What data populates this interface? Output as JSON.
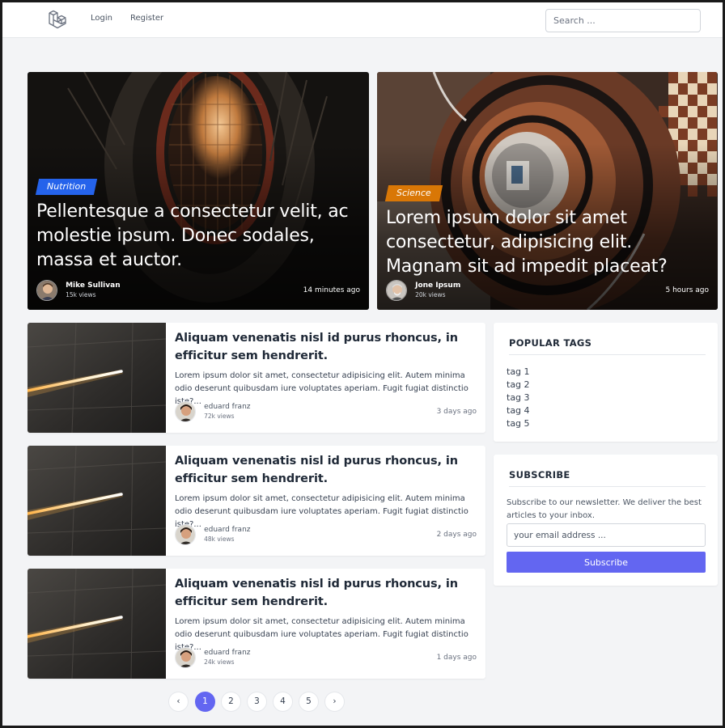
{
  "nav": {
    "login": "Login",
    "register": "Register",
    "search_placeholder": "Search ..."
  },
  "hero": [
    {
      "category": "Nutrition",
      "category_color": "#2563eb",
      "title": "Pellentesque a consectetur velit, ac molestie ipsum. Donec sodales, massa et auctor.",
      "author": "Mike Sullivan",
      "views": "15k views",
      "time": "14 minutes ago"
    },
    {
      "category": "Science",
      "category_color": "#d97706",
      "title": "Lorem ipsum dolor sit amet consectetur, adipisicing elit. Magnam sit ad impedit placeat?",
      "author": "Jone Ipsum",
      "views": "20k views",
      "time": "5 hours ago"
    }
  ],
  "posts": [
    {
      "title": "Aliquam venenatis nisl id purus rhoncus, in efficitur sem hendrerit.",
      "excerpt": "Lorem ipsum dolor sit amet, consectetur adipisicing elit. Autem minima odio deserunt quibusdam iure voluptates aperiam. Fugit fugiat distinctio iste?...",
      "author": "eduard franz",
      "views": "72k views",
      "time": "3 days ago"
    },
    {
      "title": "Aliquam venenatis nisl id purus rhoncus, in efficitur sem hendrerit.",
      "excerpt": "Lorem ipsum dolor sit amet, consectetur adipisicing elit. Autem minima odio deserunt quibusdam iure voluptates aperiam. Fugit fugiat distinctio iste?...",
      "author": "eduard franz",
      "views": "48k views",
      "time": "2 days ago"
    },
    {
      "title": "Aliquam venenatis nisl id purus rhoncus, in efficitur sem hendrerit.",
      "excerpt": "Lorem ipsum dolor sit amet, consectetur adipisicing elit. Autem minima odio deserunt quibusdam iure voluptates aperiam. Fugit fugiat distinctio iste?...",
      "author": "eduard franz",
      "views": "24k views",
      "time": "1 days ago"
    }
  ],
  "sidebar": {
    "tags_title": "POPULAR TAGS",
    "tags": [
      "tag 1",
      "tag 2",
      "tag 3",
      "tag 4",
      "tag 5"
    ],
    "subscribe_title": "SUBSCRIBE",
    "subscribe_text": "Subscribe to our newsletter. We deliver the best articles to your inbox.",
    "email_placeholder": "your email address ...",
    "subscribe_button": "Subscribe"
  },
  "pagination": {
    "prev": "‹",
    "pages": [
      "1",
      "2",
      "3",
      "4",
      "5"
    ],
    "current": "1",
    "next": "›"
  },
  "colors": {
    "accent": "#6366f1",
    "background": "#f3f4f6"
  }
}
